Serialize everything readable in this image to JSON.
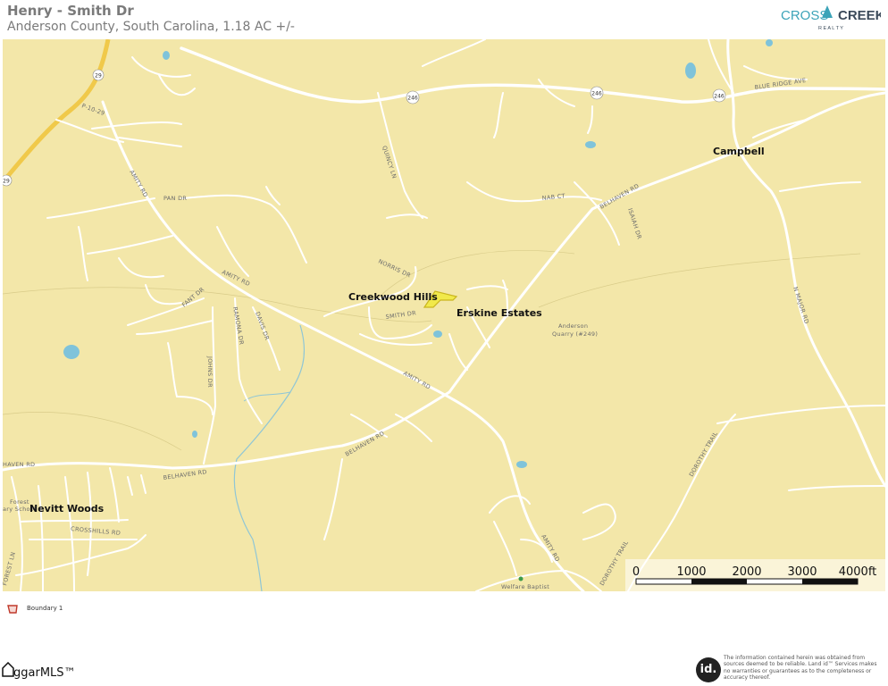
{
  "header": {
    "title": "Henry - Smith Dr",
    "subtitle": "Anderson County, South Carolina, 1.18 AC +/-"
  },
  "brand": {
    "name_line1_a": "CROSS",
    "name_line1_b": "CREEK",
    "name_line2": "R E A L T Y",
    "color_teal": "#3ba3b8",
    "color_dark": "#3b4a5a"
  },
  "map": {
    "land_color": "#f3e7a9",
    "road_color": "#ffffff",
    "water_color": "#7fc3da",
    "highway_color": "#f0c94a",
    "parcel_color": "#e9e233",
    "places": {
      "campbell": "Campbell",
      "creekwood_hills": "Creekwood Hills",
      "erskine_estates": "Erskine Estates",
      "nevitt_woods": "Nevitt Woods"
    },
    "road_labels": {
      "blue_ridge_ave": "BLUE RIDGE AVE",
      "r246_a": "246",
      "r246_b": "246",
      "r246_c": "246",
      "r29_a": "29",
      "r29_b": "29",
      "p1029": "P-10-29",
      "quincy": "QUINCY LN",
      "nab": "NAB CT",
      "belhaven_ne": "BELHAVEN RD",
      "isaiah": "ISAIAH DR",
      "amity_nw": "AMITY RD",
      "pan": "PAN DR",
      "amity_mid": "AMITY RD",
      "norris": "NORRIS DR",
      "smith": "SMITH DR",
      "fant": "FANT DR",
      "ramona": "RAMONA DR",
      "davis": "DAVIS DR",
      "johns": "JOHNS DR",
      "amity_se": "AMITY RD",
      "n_major": "N MAJOR RD",
      "belhaven_sw1": "BELHAVEN RD",
      "belhaven_sw2": "BELHAVEN RD",
      "belhaven_w": "HAVEN RD",
      "crosshills": "CROSSHILLS RD",
      "forest": "FOREST LN",
      "amity_s": "AMITY RD",
      "dorothy_a": "DOROTHY TRAIL",
      "dorothy_b": "DOROTHY TRAIL",
      "anderson_quarry_1": "Anderson",
      "anderson_quarry_2": "Quarry (#249)",
      "welfare_baptist": "Welfare Baptist",
      "forest_school_1": "Forest",
      "forest_school_2": "ary School"
    },
    "scale_bar": {
      "ticks": [
        "0",
        "1000",
        "2000",
        "3000",
        "4000ft"
      ]
    }
  },
  "legend": {
    "label": "Boundary 1",
    "color": "#c0392b"
  },
  "footer": {
    "mls": "ggarMLS™",
    "id_logo": "id.",
    "disclaimer": "The information contained herein was obtained from sources deemed to be reliable. Land id™ Services makes no warranties or guarantees as to the completeness or accuracy thereof."
  }
}
